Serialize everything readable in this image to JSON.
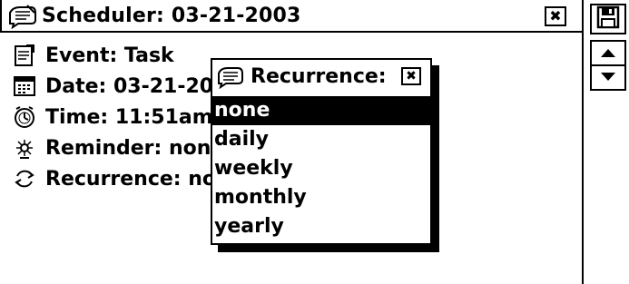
{
  "window": {
    "title": "Scheduler: 03-21-2003",
    "close_glyph": "✖"
  },
  "fields": [
    {
      "icon": "event-icon",
      "text": "Event: Task"
    },
    {
      "icon": "calendar-icon",
      "text": "Date: 03-21-2003"
    },
    {
      "icon": "clock-icon",
      "text": "Time: 11:51am"
    },
    {
      "icon": "alarm-icon",
      "text": "Reminder: none"
    },
    {
      "icon": "recurrence-icon",
      "text": "Recurrence: none"
    }
  ],
  "popup": {
    "title": "Recurrence:",
    "close_glyph": "✖",
    "options": [
      "none",
      "daily",
      "weekly",
      "monthly",
      "yearly"
    ],
    "selected": "none"
  },
  "toolbar": {
    "save": "save-icon",
    "up": "scroll-up-icon",
    "down": "scroll-down-icon"
  }
}
